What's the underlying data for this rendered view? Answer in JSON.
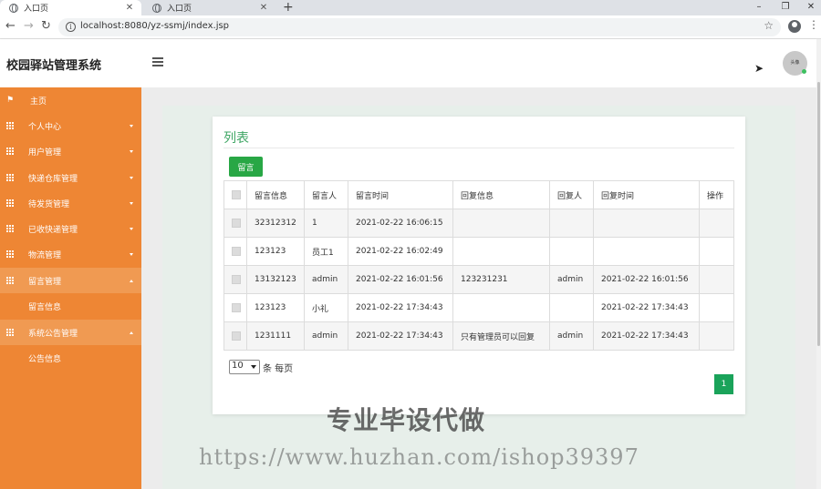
{
  "browser": {
    "tabs": [
      {
        "title": "入口页",
        "close": "✕"
      },
      {
        "title": "入口页",
        "close": "✕"
      }
    ],
    "new_tab": "+",
    "window_controls": {
      "minimize": "–",
      "maximize": "❐",
      "close": "✕"
    },
    "nav": {
      "back": "←",
      "forward": "→",
      "reload": "↻"
    },
    "url": "localhost:8080/yz-ssmj/index.jsp",
    "info_glyph": "i",
    "bookmark_star": "☆",
    "menu_glyph": "⋮"
  },
  "header": {
    "title": "校园驿站管理系统",
    "avatar_text": "头像"
  },
  "sidebar": {
    "items": [
      {
        "label": "主页",
        "icon": "flag-icon"
      },
      {
        "label": "个人中心",
        "icon": "grid-icon"
      },
      {
        "label": "用户管理",
        "icon": "grid-icon"
      },
      {
        "label": "快递仓库管理",
        "icon": "grid-icon"
      },
      {
        "label": "待发货管理",
        "icon": "grid-icon"
      },
      {
        "label": "已收快递管理",
        "icon": "grid-icon"
      },
      {
        "label": "物流管理",
        "icon": "grid-icon"
      },
      {
        "label": "留言管理",
        "icon": "grid-icon"
      },
      {
        "label": "留言信息"
      },
      {
        "label": "系统公告管理",
        "icon": "grid-icon"
      },
      {
        "label": "公告信息"
      }
    ]
  },
  "card": {
    "title": "列表",
    "add_button": "留言"
  },
  "table": {
    "headers": [
      "",
      "留言信息",
      "留言人",
      "留言时间",
      "回复信息",
      "回复人",
      "回复时间",
      "操作"
    ],
    "rows": [
      {
        "message": "32312312",
        "author": "1",
        "time": "2021-02-22 16:06:15",
        "reply": "",
        "replier": "",
        "reply_time": ""
      },
      {
        "message": "123123",
        "author": "员工1",
        "time": "2021-02-22 16:02:49",
        "reply": "",
        "replier": "",
        "reply_time": ""
      },
      {
        "message": "13132123",
        "author": "admin",
        "time": "2021-02-22 16:01:56",
        "reply": "123231231",
        "replier": "admin",
        "reply_time": "2021-02-22 16:01:56"
      },
      {
        "message": "123123",
        "author": "小礼",
        "time": "2021-02-22 17:34:43",
        "reply": "",
        "replier": "",
        "reply_time": "2021-02-22 17:34:43"
      },
      {
        "message": "1231111",
        "author": "admin",
        "time": "2021-02-22 17:34:43",
        "reply": "只有管理员可以回复",
        "replier": "admin",
        "reply_time": "2021-02-22 17:34:43"
      }
    ]
  },
  "pager": {
    "page_size": "10",
    "suffix": "条 每页",
    "current_page": "1"
  },
  "watermark": {
    "line1": "专业毕设代做",
    "line2": "https://www.huzhan.com/ishop39397"
  },
  "colors": {
    "sidebar": "#ee8634",
    "accent_green": "#28a745",
    "title_green": "#3fa664"
  }
}
